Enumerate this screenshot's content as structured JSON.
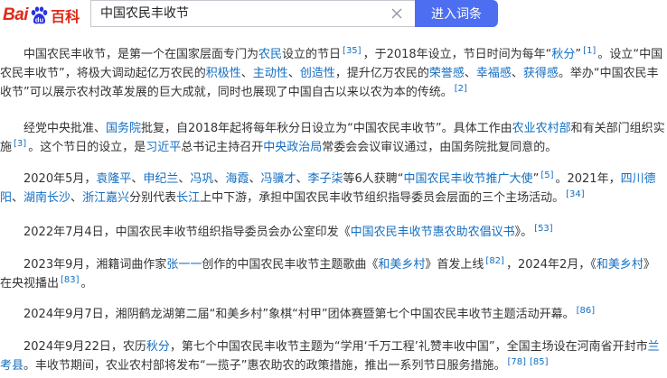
{
  "header": {
    "logo_bai": "Bai",
    "logo_du": "du",
    "logo_baike": "百科",
    "search_value": "中国农民丰收节",
    "enter_button": "进入词条"
  },
  "colors": {
    "accent": "#4e6ef2",
    "link": "#136ec2",
    "brand_red": "#de2a18",
    "brand_blue": "#2932e1"
  },
  "icons": {
    "clear": "close-icon",
    "logo": "baidu-paw-icon"
  },
  "paragraphs": [
    [
      {
        "t": "中国农民丰收节，是第一个在国家层面专门为"
      },
      {
        "l": "农民"
      },
      {
        "t": "设立的节日"
      },
      {
        "r": "[35]"
      },
      {
        "t": "，于2018年设立，节日时间为每年“"
      },
      {
        "l": "秋分"
      },
      {
        "t": "”"
      },
      {
        "r": "[1]"
      },
      {
        "t": "。设立“中国农民丰收节”，将极大调动起亿万农民的"
      },
      {
        "l": "积极性"
      },
      {
        "t": "、"
      },
      {
        "l": "主动性"
      },
      {
        "t": "、"
      },
      {
        "l": "创造性"
      },
      {
        "t": "，提升亿万农民的"
      },
      {
        "l": "荣誉感"
      },
      {
        "t": "、"
      },
      {
        "l": "幸福感"
      },
      {
        "t": "、"
      },
      {
        "l": "获得感"
      },
      {
        "t": "。举办“中国农民丰收节”可以展示农村改革发展的巨大成就，同时也展现了中国自古以来以农为本的传统。"
      },
      {
        "r": "[2]"
      }
    ],
    [
      {
        "t": "经党中央批准、"
      },
      {
        "l": "国务院"
      },
      {
        "t": "批复，自2018年起将每年秋分日设立为“中国农民丰收节”。具体工作由"
      },
      {
        "l": "农业农村部"
      },
      {
        "t": "和有关部门组织实施"
      },
      {
        "r": "[3]"
      },
      {
        "t": "。这个节日的设立，是"
      },
      {
        "l": "习近平"
      },
      {
        "t": "总书记主持召开"
      },
      {
        "l": "中央政治局"
      },
      {
        "t": "常委会会议审议通过，由国务院批复同意的。"
      }
    ],
    [
      {
        "t": "2020年5月，"
      },
      {
        "l": "袁隆平"
      },
      {
        "t": "、"
      },
      {
        "l": "申纪兰"
      },
      {
        "t": "、"
      },
      {
        "l": "冯巩"
      },
      {
        "t": "、"
      },
      {
        "l": "海霞"
      },
      {
        "t": "、"
      },
      {
        "l": "冯骥才"
      },
      {
        "t": "、"
      },
      {
        "l": "李子柒"
      },
      {
        "t": "等6人获聘“"
      },
      {
        "l": "中国农民丰收节推广大使"
      },
      {
        "t": "”"
      },
      {
        "r": "[5]"
      },
      {
        "t": "。2021年，"
      },
      {
        "l": "四川德阳"
      },
      {
        "t": "、"
      },
      {
        "l": "湖南长沙"
      },
      {
        "t": "、"
      },
      {
        "l": "浙江嘉兴"
      },
      {
        "t": "分别代表"
      },
      {
        "l": "长江"
      },
      {
        "t": "上中下游，承担中国农民丰收节组织指导委员会层面的三个主场活动。"
      },
      {
        "r": "[34]"
      }
    ],
    [
      {
        "t": "2022年7月4日，中国农民丰收节组织指导委员会办公室印发《"
      },
      {
        "l": "中国农民丰收节惠农助农倡议书"
      },
      {
        "t": "》。"
      },
      {
        "r": "[53]"
      }
    ],
    [
      {
        "t": "2023年9月，湘籍词曲作家"
      },
      {
        "l": "张一一"
      },
      {
        "t": "创作的中国农民丰收节主题歌曲《"
      },
      {
        "l": "和美乡村"
      },
      {
        "t": "》首发上线"
      },
      {
        "r": "[82]"
      },
      {
        "t": "，2024年2月，《"
      },
      {
        "l": "和美乡村"
      },
      {
        "t": "》在央视播出"
      },
      {
        "r": "[83]"
      },
      {
        "t": "。"
      }
    ],
    [
      {
        "t": "2024年9月7日，湘阴鹤龙湖第二届“和美乡村”象棋“村甲”团体赛暨第七个中国农民丰收节主题活动开幕。"
      },
      {
        "r": "[86]"
      }
    ],
    [
      {
        "t": "2024年9月22日，农历"
      },
      {
        "l": "秋分"
      },
      {
        "t": "，第七个中国农民丰收节主题为“学用‘千万工程’礼赞丰收中国”，全国主场设在河南省开封市"
      },
      {
        "l": "兰考县"
      },
      {
        "t": "。丰收节期间，农业农村部将发布“一揽子”惠农助农的政策措施，推出一系列节日服务措施。"
      },
      {
        "r": "[78]"
      },
      {
        "r": "[85]"
      }
    ]
  ]
}
